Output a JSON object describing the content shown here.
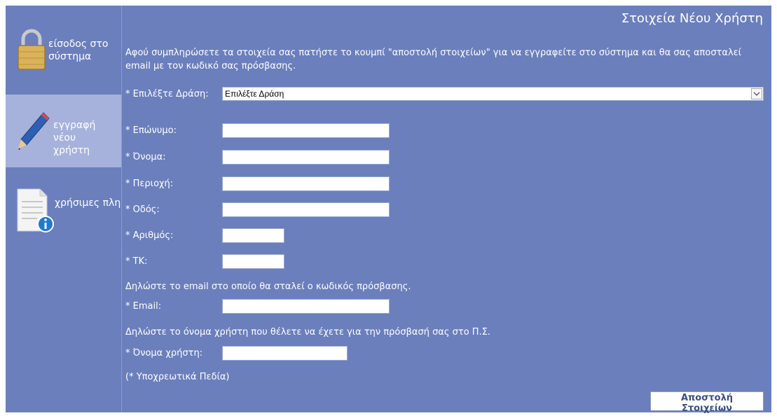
{
  "sidebar": {
    "items": [
      {
        "label": "είσοδος στο σύστημα"
      },
      {
        "label": "εγγραφή νέου χρήστη"
      },
      {
        "label": "χρήσιμες πληροφορίες"
      }
    ]
  },
  "main": {
    "title": "Στοιχεία Νέου Χρήστη",
    "intro": "Αφού συμπληρώσετε τα στοιχεία σας πατήστε το κουμπί \"αποστολή στοιχείων\" για να εγγραφείτε στο σύστημα και θα σας αποσταλεί email με τον κωδικό σας πρόσβασης.",
    "action_label": "* Επιλέξτε Δράση:",
    "action_selected": "Επιλέξτε Δράση",
    "fields": {
      "surname": {
        "label": "* Επώνυμο:",
        "value": ""
      },
      "name": {
        "label": "* Όνομα:",
        "value": ""
      },
      "region": {
        "label": "* Περιοχή:",
        "value": ""
      },
      "street": {
        "label": "* Οδός:",
        "value": ""
      },
      "number": {
        "label": "* Αριθμός:",
        "value": ""
      },
      "postcode": {
        "label": "* ΤΚ:",
        "value": ""
      },
      "email": {
        "label": "* Email:",
        "value": ""
      },
      "username": {
        "label": "* Όνομα χρήστη:",
        "value": ""
      }
    },
    "email_note": "Δηλώστε το email στο οποίο θα σταλεί ο κωδικός πρόσβασης.",
    "username_note": "Δηλώστε το όνομα χρήστη που θέλετε να έχετε για την πρόσβασή σας στο Π.Σ.",
    "required_note": "(*  Υποχρεωτικά Πεδία)",
    "submit_label": "Αποστολή Στοιχείων"
  },
  "colors": {
    "background": "#6b7fbd",
    "sidebar_active": "#a6b2dc",
    "text": "#ffffff"
  },
  "icons": [
    "padlock-icon",
    "pencil-icon",
    "document-info-icon",
    "chevron-down-icon"
  ]
}
